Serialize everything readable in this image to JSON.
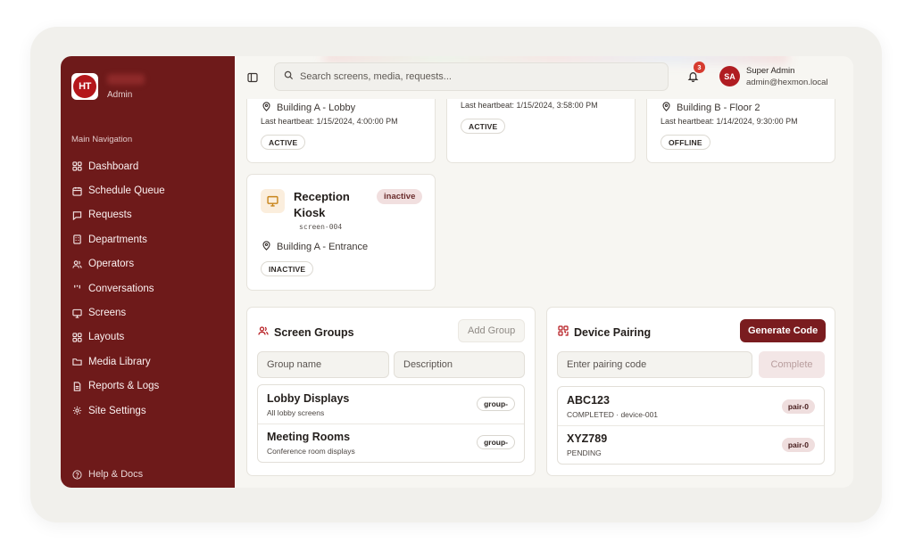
{
  "sidebar": {
    "logo_text": "HT",
    "brand_subtitle": "Admin",
    "nav_heading": "Main Navigation",
    "items": [
      {
        "label": "Dashboard",
        "icon": "grid-icon"
      },
      {
        "label": "Schedule Queue",
        "icon": "calendar-icon"
      },
      {
        "label": "Requests",
        "icon": "message-square-icon"
      },
      {
        "label": "Departments",
        "icon": "building-icon"
      },
      {
        "label": "Operators",
        "icon": "users-icon"
      },
      {
        "label": "Conversations",
        "icon": "chat-icon"
      },
      {
        "label": "Screens",
        "icon": "monitor-icon"
      },
      {
        "label": "Layouts",
        "icon": "layout-icon"
      },
      {
        "label": "Media Library",
        "icon": "folder-icon"
      },
      {
        "label": "Reports & Logs",
        "icon": "file-icon"
      },
      {
        "label": "Site Settings",
        "icon": "gear-icon"
      }
    ],
    "help_label": "Help & Docs"
  },
  "topbar": {
    "search_placeholder": "Search screens, media, requests...",
    "notification_count": "3",
    "user": {
      "initials": "SA",
      "name": "Super Admin",
      "email": "admin@hexmon.local"
    }
  },
  "screens": [
    {
      "location": "Building A - Lobby",
      "heartbeat": "Last heartbeat: 1/15/2024, 4:00:00 PM",
      "status": "ACTIVE"
    },
    {
      "location": "",
      "heartbeat": "Last heartbeat: 1/15/2024, 3:58:00 PM",
      "status": "ACTIVE"
    },
    {
      "location": "Building B - Floor 2",
      "heartbeat": "Last heartbeat: 1/14/2024, 9:30:00 PM",
      "status": "OFFLINE"
    },
    {
      "name": "Reception Kiosk",
      "code": "screen-004",
      "badge": "inactive",
      "location": "Building A - Entrance",
      "status": "INACTIVE"
    }
  ],
  "screen_groups": {
    "title": "Screen Groups",
    "add_button": "Add Group",
    "name_placeholder": "Group name",
    "description_placeholder": "Description",
    "groups": [
      {
        "name": "Lobby Displays",
        "description": "All lobby screens",
        "tag": "group-"
      },
      {
        "name": "Meeting Rooms",
        "description": "Conference room displays",
        "tag": "group-"
      }
    ]
  },
  "device_pairing": {
    "title": "Device Pairing",
    "generate_button": "Generate Code",
    "code_placeholder": "Enter pairing code",
    "complete_button": "Complete",
    "pairings": [
      {
        "code": "ABC123",
        "status": "COMPLETED · device-001",
        "tag": "pair-0"
      },
      {
        "code": "XYZ789",
        "status": "PENDING",
        "tag": "pair-0"
      }
    ]
  },
  "colors": {
    "sidebar": "#6e1a1a",
    "accent": "#7a1c1f",
    "badge": "#d63b2f"
  }
}
